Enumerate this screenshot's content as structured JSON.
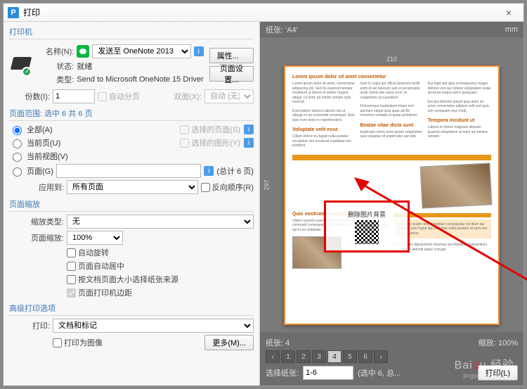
{
  "title": "打印",
  "printer": {
    "section": "打印机",
    "name_label": "名称(N):",
    "name_value": "发送至 OneNote 2013",
    "status_label": "状态:",
    "status_value": "就绪",
    "type_label": "类型:",
    "type_value": "Send to Microsoft OneNote 15 Driver",
    "copies_label": "份数(I):",
    "copies_value": "1",
    "collate": "自动分页",
    "duplex_label": "双面(X):",
    "duplex_value": "自动 (无)",
    "properties_btn": "属性...",
    "page_setup_btn": "页面设置..."
  },
  "range": {
    "section": "页面范围: 选中 6 共 6 页",
    "all": "全部(A)",
    "current_page": "当前页(U)",
    "current_view": "当前视图(V)",
    "pages": "页面(G)",
    "count": "(总计 6 页)",
    "selected_disabled": "选择的页面(S)",
    "graphics_disabled": "选择的图形(Y)",
    "apply_label": "应用到:",
    "apply_value": "所有页面",
    "reverse": "反向顺序(R)"
  },
  "zoom": {
    "section": "页面缩放",
    "type_label": "缩放类型:",
    "type_value": "无",
    "scale_label": "页面缩放:",
    "scale_value": "100%",
    "auto_rotate": "自动旋转",
    "auto_center": "页面自动居中",
    "by_pdf_size": "按文档页面大小选择纸张来源",
    "print_margins": "页面打印机边距"
  },
  "adv": {
    "section": "高级打印选项",
    "print_label": "打印:",
    "print_value": "文档和标记",
    "as_image": "打印为图像",
    "more_btn": "更多(M)..."
  },
  "preview": {
    "paper": "纸张: 'A4'",
    "unit": "mm",
    "ruler_w": "210",
    "ruler_h": "297",
    "pages_label": "纸张: 4",
    "zoom_label": "缩放: 100%",
    "select_label": "选择纸张:",
    "select_value": "1-6",
    "select_count": "(选中 6, 总...",
    "print_btn": "打印(L)",
    "pages": [
      "1",
      "2",
      "3",
      "4",
      "5",
      "6"
    ],
    "active_page": 4,
    "qr_title": "删除图片背景"
  }
}
